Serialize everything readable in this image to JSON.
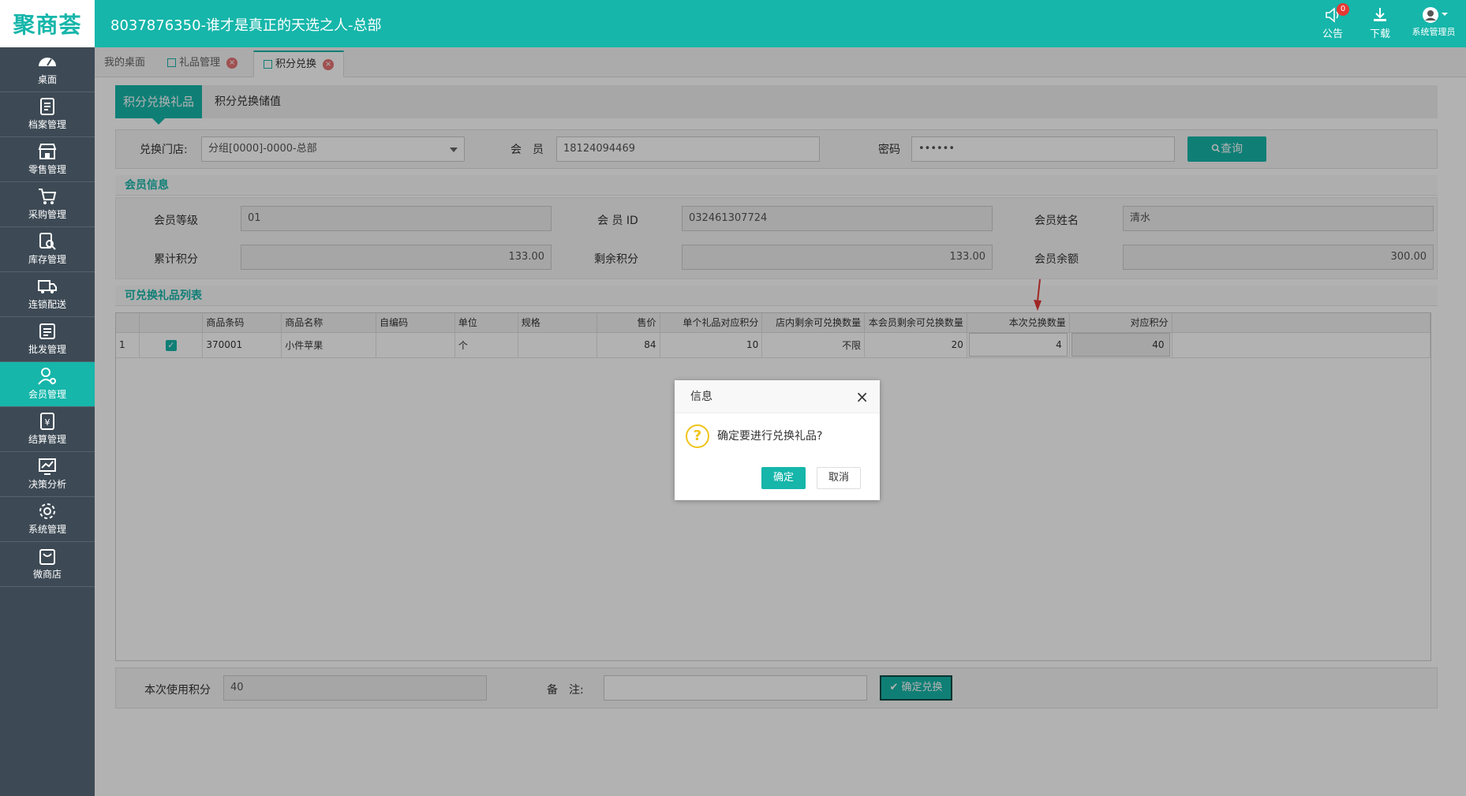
{
  "header": {
    "logo": "聚商荟",
    "title": "8037876350-谁才是真正的天选之人-总部",
    "notice_label": "公告",
    "notice_count": "0",
    "download_label": "下载",
    "user_label": "系统管理员"
  },
  "sidebar": {
    "items": [
      {
        "label": "桌面",
        "icon": "dashboard-icon"
      },
      {
        "label": "档案管理",
        "icon": "archive-icon"
      },
      {
        "label": "零售管理",
        "icon": "store-icon"
      },
      {
        "label": "采购管理",
        "icon": "cart-icon"
      },
      {
        "label": "库存管理",
        "icon": "inventory-icon"
      },
      {
        "label": "连锁配送",
        "icon": "truck-icon"
      },
      {
        "label": "批发管理",
        "icon": "wholesale-icon"
      },
      {
        "label": "会员管理",
        "icon": "member-icon"
      },
      {
        "label": "结算管理",
        "icon": "settlement-icon"
      },
      {
        "label": "决策分析",
        "icon": "chart-icon"
      },
      {
        "label": "系统管理",
        "icon": "gear-icon"
      },
      {
        "label": "微商店",
        "icon": "bag-icon"
      }
    ],
    "active_index": 7
  },
  "tabs": [
    {
      "label": "我的桌面"
    },
    {
      "label": "礼品管理"
    },
    {
      "label": "积分兑换"
    }
  ],
  "subtabs": [
    {
      "label": "积分兑换礼品"
    },
    {
      "label": "积分兑换储值"
    }
  ],
  "search": {
    "store_label": "兑换门店:",
    "store_value": "分组[0000]-0000-总部",
    "member_label": "会　员",
    "member_value": "18124094469",
    "password_label": "密码",
    "password_value": "••••••",
    "query_label": "查询"
  },
  "member_info": {
    "section_title": "会员信息",
    "level_label": "会员等级",
    "level_value": "01",
    "id_label": "会 员 ID",
    "id_value": "032461307724",
    "name_label": "会员姓名",
    "name_value": "清水",
    "total_points_label": "累计积分",
    "total_points_value": "133.00",
    "remaining_points_label": "剩余积分",
    "remaining_points_value": "133.00",
    "balance_label": "会员余额",
    "balance_value": "300.00"
  },
  "gift_list": {
    "section_title": "可兑换礼品列表",
    "columns": [
      "",
      "",
      "商品条码",
      "商品名称",
      "自编码",
      "单位",
      "规格",
      "售价",
      "单个礼品对应积分",
      "店内剩余可兑换数量",
      "本会员剩余可兑换数量",
      "本次兑换数量",
      "对应积分"
    ],
    "rows": [
      {
        "index": "1",
        "barcode": "370001",
        "name": "小件苹果",
        "code": "",
        "unit": "个",
        "spec": "",
        "price": "84",
        "points_each": "10",
        "store_remaining": "不限",
        "member_remaining": "20",
        "qty": "4",
        "points": "40"
      }
    ]
  },
  "bottom": {
    "used_points_label": "本次使用积分",
    "used_points_value": "40",
    "remark_label": "备　注:",
    "remark_value": "",
    "confirm_label": "确定兑换"
  },
  "dialog": {
    "title": "信息",
    "message": "确定要进行兑换礼品?",
    "ok_label": "确定",
    "cancel_label": "取消"
  },
  "colors": {
    "brand": "#16b6aa",
    "sidebar": "#3d4a55"
  }
}
